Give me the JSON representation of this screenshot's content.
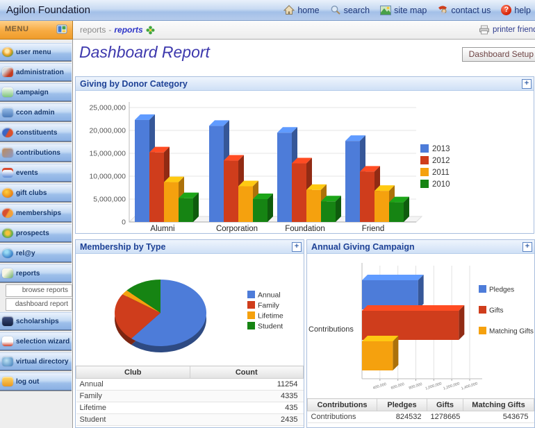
{
  "app": {
    "title": "Agilon Foundation"
  },
  "topnav": {
    "items": [
      {
        "label": "home"
      },
      {
        "label": "search"
      },
      {
        "label": "site map"
      },
      {
        "label": "contact us"
      },
      {
        "label": "help"
      }
    ]
  },
  "menu": {
    "label": "MENU"
  },
  "breadcrumb": {
    "section": "reports",
    "separator": "-",
    "current": "reports"
  },
  "toolbar": {
    "printer_label": "printer friendly",
    "setup_button": "Dashboard Setup"
  },
  "page": {
    "title": "Dashboard Report"
  },
  "icons": {
    "expand_glyph": "+",
    "help_glyph": "?"
  },
  "sidebar": {
    "items": [
      {
        "label": "user menu"
      },
      {
        "label": "administration"
      },
      {
        "label": "campaign"
      },
      {
        "label": "ccon admin"
      },
      {
        "label": "constituents"
      },
      {
        "label": "contributions"
      },
      {
        "label": "events"
      },
      {
        "label": "gift clubs"
      },
      {
        "label": "memberships"
      },
      {
        "label": "prospects"
      },
      {
        "label": "rel@y"
      },
      {
        "label": "reports"
      }
    ],
    "sub_items": [
      {
        "label": "browse reports"
      },
      {
        "label": "dashboard report"
      }
    ],
    "items_after": [
      {
        "label": "scholarships"
      },
      {
        "label": "selection wizard"
      },
      {
        "label": "virtual directory"
      },
      {
        "label": "log out"
      }
    ]
  },
  "panels": {
    "giving": {
      "title": "Giving by Donor Category"
    },
    "membership": {
      "title": "Membership by Type",
      "table": {
        "headers": [
          "Club",
          "Count"
        ],
        "rows": [
          [
            "Annual",
            "11254"
          ],
          [
            "Family",
            "4335"
          ],
          [
            "Lifetime",
            "435"
          ],
          [
            "Student",
            "2435"
          ]
        ]
      }
    },
    "campaign": {
      "title": "Annual Giving Campaign",
      "table": {
        "headers": [
          "Contributions",
          "Pledges",
          "Gifts",
          "Matching Gifts"
        ],
        "rows": [
          [
            "Contributions",
            "824532",
            "1278665",
            "543675"
          ]
        ]
      }
    }
  },
  "chart_data": [
    {
      "type": "bar",
      "variant": "3d-grouped-vertical",
      "title": "Giving by Donor Category",
      "categories": [
        "Alumni",
        "Corporation",
        "Foundation",
        "Friend"
      ],
      "series": [
        {
          "name": "2013",
          "color": "#4D7CD9",
          "values": [
            22300000,
            21000000,
            19500000,
            17700000
          ]
        },
        {
          "name": "2012",
          "color": "#CF3D1C",
          "values": [
            15200000,
            13400000,
            12800000,
            11000000
          ]
        },
        {
          "name": "2011",
          "color": "#F5A10E",
          "values": [
            8700000,
            7800000,
            7000000,
            6800000
          ]
        },
        {
          "name": "2010",
          "color": "#168413",
          "values": [
            5200000,
            5000000,
            4500000,
            4300000
          ]
        }
      ],
      "xlabel": "",
      "ylabel": "",
      "ylim": [
        0,
        25000000
      ],
      "ytick_step": 5000000,
      "grid": true,
      "legend_position": "right"
    },
    {
      "type": "pie",
      "variant": "3d",
      "title": "Membership by Type",
      "labels": [
        "Annual",
        "Family",
        "Lifetime",
        "Student"
      ],
      "values": [
        11254,
        4335,
        435,
        2435
      ],
      "colors": [
        "#4D7CD9",
        "#CF3D1C",
        "#F5A10E",
        "#168413"
      ],
      "legend_position": "right"
    },
    {
      "type": "bar",
      "variant": "3d-horizontal",
      "title": "Annual Giving Campaign",
      "categories": [
        "Contributions"
      ],
      "series": [
        {
          "name": "Pledges",
          "color": "#4D7CD9",
          "values": [
            824532
          ]
        },
        {
          "name": "Gifts",
          "color": "#CF3D1C",
          "values": [
            1278665
          ]
        },
        {
          "name": "Matching Gifts",
          "color": "#F5A10E",
          "values": [
            543675
          ]
        }
      ],
      "xlim": [
        200000,
        1450000
      ],
      "xticks": [
        400000,
        600000,
        800000,
        1000000,
        1200000,
        1400000
      ],
      "grid": true,
      "legend_position": "right"
    }
  ],
  "colors": {
    "header_text": "#1e4296",
    "panel_border": "#a8bede",
    "menu_orange": "#f5a13d",
    "series_blue": "#4D7CD9",
    "series_red": "#CF3D1C",
    "series_orange": "#F5A10E",
    "series_green": "#168413"
  }
}
